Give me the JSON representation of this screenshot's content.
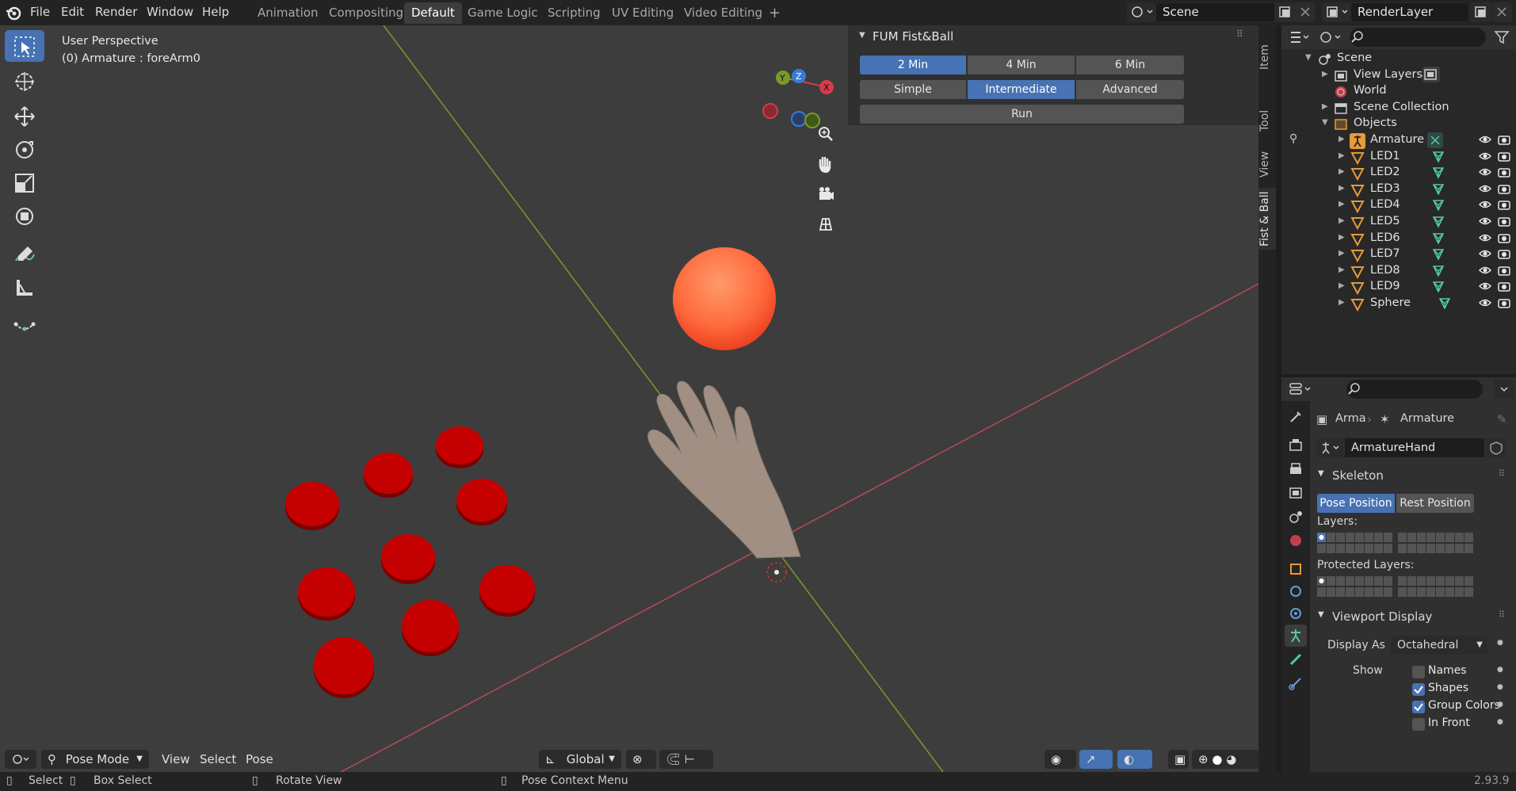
{
  "menu": [
    "File",
    "Edit",
    "Render",
    "Window",
    "Help"
  ],
  "workspaces": [
    "Animation",
    "Compositing",
    "Default",
    "Game Logic",
    "Scripting",
    "UV Editing",
    "Video Editing"
  ],
  "active_workspace": "Default",
  "scene_name": "Scene",
  "view_layer": "RenderLayer",
  "viewport": {
    "title": "User Perspective",
    "subtitle": "(0) Armature : foreArm0",
    "gizmo": {
      "x": "X",
      "y": "Y",
      "z": "Z"
    }
  },
  "npanel": {
    "title": "FUM Fist&Ball",
    "durations": [
      "2 Min",
      "4 Min",
      "6 Min"
    ],
    "active_duration": "2 Min",
    "levels": [
      "Simple",
      "Intermediate",
      "Advanced"
    ],
    "active_level": "Intermediate",
    "run_label": "Run",
    "tabs": [
      "Item",
      "Tool",
      "View",
      "Fist & Ball"
    ]
  },
  "outliner": {
    "rows": [
      {
        "label": "Scene",
        "indent": 0,
        "type": "scene"
      },
      {
        "label": "View Layers",
        "indent": 1,
        "type": "viewlayer"
      },
      {
        "label": "World",
        "indent": 1,
        "type": "world"
      },
      {
        "label": "Scene Collection",
        "indent": 1,
        "type": "collection"
      },
      {
        "label": "Objects",
        "indent": 1,
        "type": "objects"
      },
      {
        "label": "Armature",
        "indent": 2,
        "type": "armature"
      },
      {
        "label": "LED1",
        "indent": 2,
        "type": "mesh"
      },
      {
        "label": "LED2",
        "indent": 2,
        "type": "mesh"
      },
      {
        "label": "LED3",
        "indent": 2,
        "type": "mesh"
      },
      {
        "label": "LED4",
        "indent": 2,
        "type": "mesh"
      },
      {
        "label": "LED5",
        "indent": 2,
        "type": "mesh"
      },
      {
        "label": "LED6",
        "indent": 2,
        "type": "mesh"
      },
      {
        "label": "LED7",
        "indent": 2,
        "type": "mesh"
      },
      {
        "label": "LED8",
        "indent": 2,
        "type": "mesh"
      },
      {
        "label": "LED9",
        "indent": 2,
        "type": "mesh"
      },
      {
        "label": "Sphere",
        "indent": 2,
        "type": "mesh"
      }
    ]
  },
  "properties": {
    "breadcrumb_object": "Arma",
    "breadcrumb_data": "Armature",
    "datablock_name": "ArmatureHand",
    "skeleton_label": "Skeleton",
    "pose_position": "Pose Position",
    "rest_position": "Rest Position",
    "layers_label": "Layers:",
    "protected_layers_label": "Protected Layers:",
    "viewport_display_label": "Viewport Display",
    "display_as_label": "Display As",
    "display_as_value": "Octahedral",
    "show_label": "Show",
    "show_options": [
      {
        "label": "Names",
        "checked": false
      },
      {
        "label": "Shapes",
        "checked": true
      },
      {
        "label": "Group Colors",
        "checked": true
      },
      {
        "label": "In Front",
        "checked": false
      }
    ]
  },
  "viewport_header": {
    "mode": "Pose Mode",
    "menus": [
      "View",
      "Select",
      "Pose"
    ],
    "orientation": "Global"
  },
  "status": {
    "select": "Select",
    "box_select": "Box Select",
    "rotate_view": "Rotate View",
    "context_menu": "Pose Context Menu",
    "version": "2.93.9"
  },
  "colors": {
    "accent": "#4772b3",
    "led_red": "#c40000",
    "sphere_orange": "#ff6a3d",
    "x_axis": "#b84a55",
    "y_axis": "#7a9a2a"
  }
}
